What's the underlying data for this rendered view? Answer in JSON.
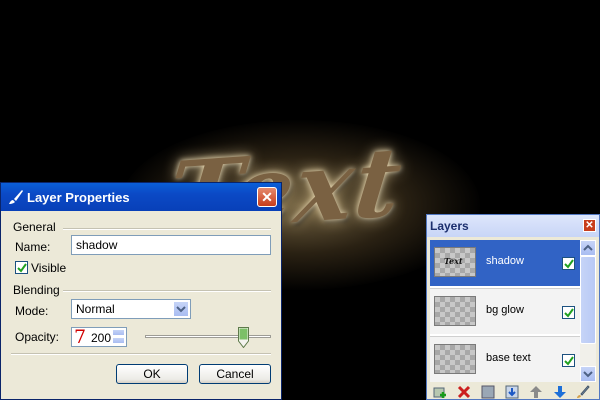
{
  "canvas": {
    "text": "Text"
  },
  "dialog": {
    "title": "Layer Properties",
    "general_label": "General",
    "name_label": "Name:",
    "name_value": "shadow",
    "visible_label": "Visible",
    "visible_checked": true,
    "blending_label": "Blending",
    "mode_label": "Mode:",
    "mode_value": "Normal",
    "opacity_label": "Opacity:",
    "opacity_value": "200",
    "opacity_max": 255,
    "ok_label": "OK",
    "cancel_label": "Cancel"
  },
  "layers_panel": {
    "title": "Layers",
    "items": [
      {
        "name": "shadow",
        "selected": true,
        "visible": true,
        "thumb_text": "Text"
      },
      {
        "name": "bg glow",
        "selected": false,
        "visible": true,
        "thumb_text": ""
      },
      {
        "name": "base text",
        "selected": false,
        "visible": true,
        "thumb_text": ""
      }
    ],
    "toolbar_icons": [
      "add-layer-icon",
      "delete-layer-icon",
      "duplicate-layer-icon",
      "merge-down-icon",
      "move-up-icon",
      "move-down-icon",
      "properties-icon"
    ]
  },
  "colors": {
    "title_bar": "#0a5fd8",
    "selection": "#3163c5",
    "close_red": "#c83d1c"
  }
}
